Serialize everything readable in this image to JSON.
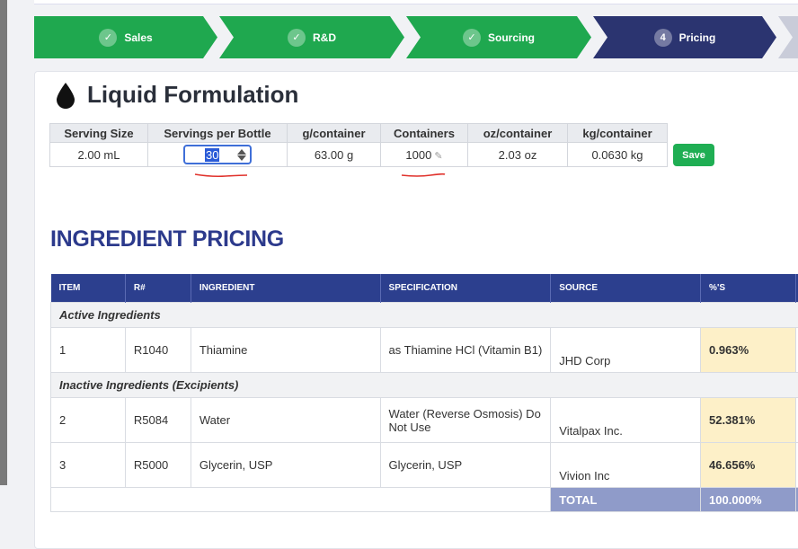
{
  "stepper": {
    "steps": [
      {
        "marker": "✓",
        "label": "Sales"
      },
      {
        "marker": "✓",
        "label": "R&D"
      },
      {
        "marker": "✓",
        "label": "Sourcing"
      },
      {
        "marker": "4",
        "label": "Pricing"
      }
    ]
  },
  "formulation": {
    "title": "Liquid Formulation",
    "icon": "droplet-icon",
    "headers": [
      "Serving Size",
      "Servings per Bottle",
      "g/container",
      "Containers",
      "oz/container",
      "kg/container"
    ],
    "serving_size": "2.00 mL",
    "servings_per_bottle": "30",
    "g_container": "63.00 g",
    "containers": "1000",
    "oz_container": "2.03 oz",
    "kg_container": "0.0630 kg",
    "save_label": "Save"
  },
  "pricing": {
    "heading": "INGREDIENT PRICING",
    "columns": [
      "ITEM",
      "R#",
      "INGREDIENT",
      "SPECIFICATION",
      "SOURCE",
      "%'S"
    ],
    "groups": {
      "active": "Active Ingredients",
      "inactive": "Inactive Ingredients (Excipients)"
    },
    "rows": [
      {
        "item": "1",
        "r": "R1040",
        "ingredient": "Thiamine",
        "spec": "as Thiamine HCl (Vitamin B1)",
        "source": "JHD Corp",
        "pct": "0.963%"
      },
      {
        "item": "2",
        "r": "R5084",
        "ingredient": "Water",
        "spec": "Water (Reverse Osmosis) Do Not Use",
        "source": "Vitalpax Inc.",
        "pct": "52.381%"
      },
      {
        "item": "3",
        "r": "R5000",
        "ingredient": "Glycerin, USP",
        "spec": "Glycerin, USP",
        "source": "Vivion Inc",
        "pct": "46.656%"
      }
    ],
    "total_label": "TOTAL",
    "total_pct": "100.000%"
  },
  "colors": {
    "step_done": "#1fa84f",
    "step_active": "#2b3470",
    "header_blue": "#2c3f8e",
    "pct_highlight": "#fdf0c8"
  }
}
